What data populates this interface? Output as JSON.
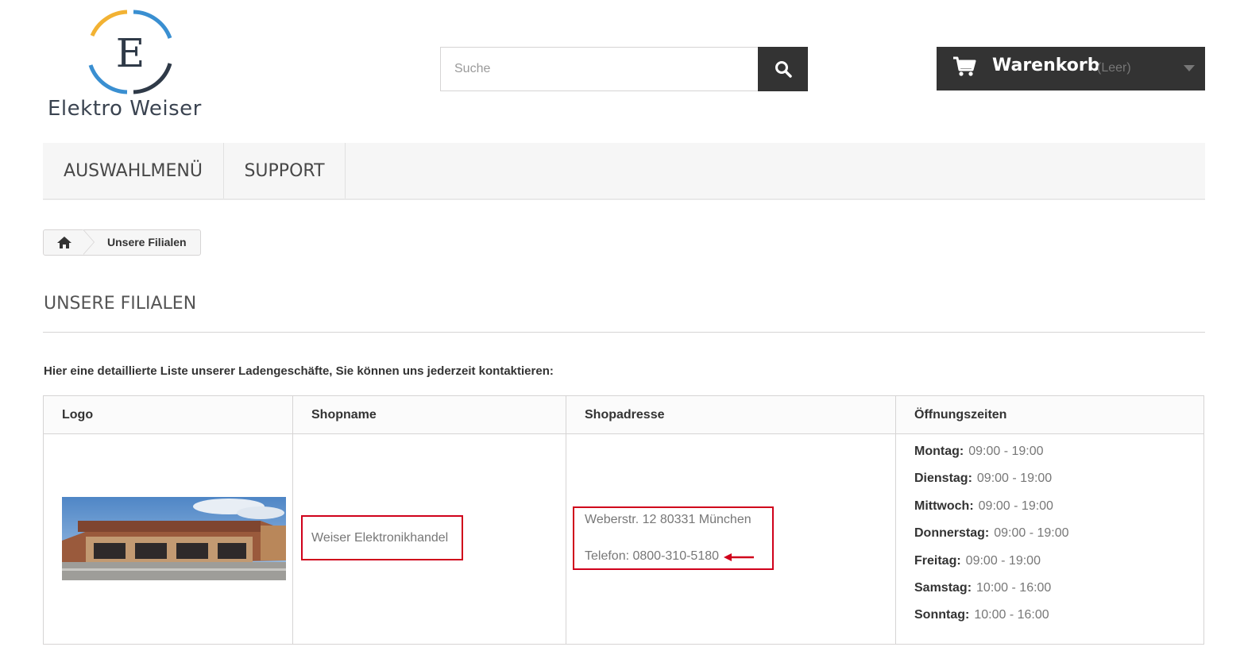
{
  "header": {
    "logo_letter": "E",
    "logo_text": "Elektro Weiser",
    "search": {
      "placeholder": "Suche"
    },
    "cart": {
      "label": "Warenkorb",
      "status": "(Leer)"
    }
  },
  "nav": {
    "items": [
      "AUSWAHLMENÜ",
      "SUPPORT"
    ]
  },
  "breadcrumb": {
    "current": "Unsere Filialen"
  },
  "page": {
    "title": "UNSERE FILIALEN",
    "intro": "Hier eine detaillierte Liste unserer Ladengeschäfte, Sie können uns jederzeit kontaktieren:"
  },
  "table": {
    "headers": [
      "Logo",
      "Shopname",
      "Shopadresse",
      "Öffnungszeiten"
    ],
    "row": {
      "shopname": "Weiser Elektronikhandel",
      "address": "Weberstr. 12 80331 München",
      "phone": "Telefon: 0800-310-5180",
      "hours": [
        {
          "day": "Montag:",
          "time": "09:00 - 19:00"
        },
        {
          "day": "Dienstag:",
          "time": "09:00 - 19:00"
        },
        {
          "day": "Mittwoch:",
          "time": "09:00 - 19:00"
        },
        {
          "day": "Donnerstag:",
          "time": "09:00 - 19:00"
        },
        {
          "day": "Freitag:",
          "time": "09:00 - 19:00"
        },
        {
          "day": "Samstag:",
          "time": "10:00 - 16:00"
        },
        {
          "day": "Sonntag:",
          "time": "10:00 - 16:00"
        }
      ]
    }
  },
  "colors": {
    "dark": "#333333",
    "highlight": "#d0011b",
    "logo_blue": "#3a8fd1",
    "logo_yellow": "#f2b233"
  }
}
